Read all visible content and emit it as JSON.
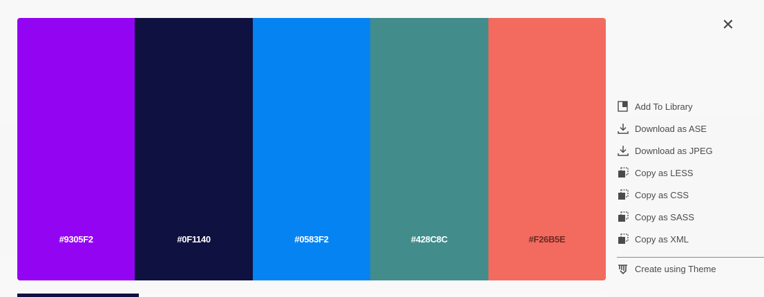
{
  "window": {
    "close_icon": "close-icon"
  },
  "palette": {
    "swatches": [
      {
        "hex": "#9305F2",
        "color": "#9305F2",
        "label_color": "#ffffff"
      },
      {
        "hex": "#0F1140",
        "color": "#0F1140",
        "label_color": "#ffffff"
      },
      {
        "hex": "#0583F2",
        "color": "#0583F2",
        "label_color": "#ffffff"
      },
      {
        "hex": "#428C8C",
        "color": "#428C8C",
        "label_color": "#ffffff"
      },
      {
        "hex": "#F26B5E",
        "color": "#F26B5E",
        "label_color": "#6b2a22"
      }
    ]
  },
  "actions": [
    {
      "label": "Add To Library",
      "icon": "library-icon"
    },
    {
      "label": "Download as ASE",
      "icon": "download-icon"
    },
    {
      "label": "Download as JPEG",
      "icon": "download-icon"
    },
    {
      "label": "Copy as LESS",
      "icon": "copy-icon"
    },
    {
      "label": "Copy as CSS",
      "icon": "copy-icon"
    },
    {
      "label": "Copy as SASS",
      "icon": "copy-icon"
    },
    {
      "label": "Copy as XML",
      "icon": "copy-icon"
    }
  ],
  "create": {
    "label": "Create using Theme",
    "icon": "brush-icon"
  }
}
